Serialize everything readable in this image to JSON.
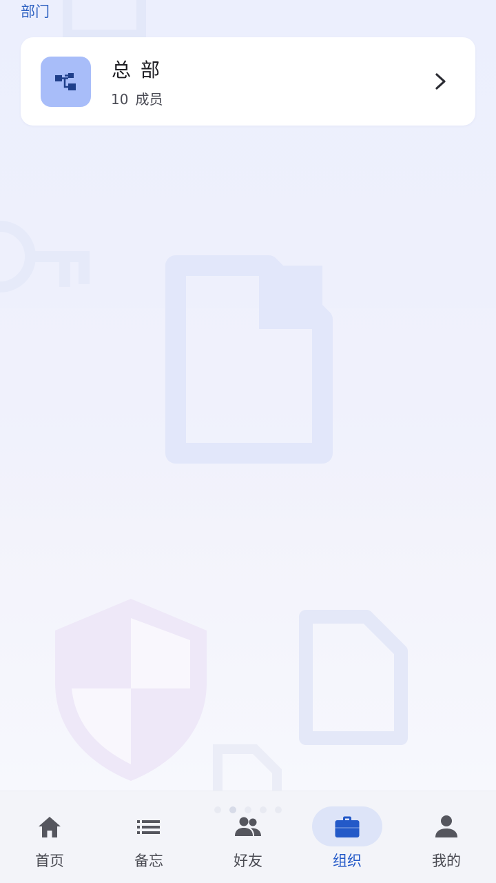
{
  "section": {
    "label": "部门"
  },
  "departments": [
    {
      "name": "总部",
      "member_count": "10",
      "member_unit": "成员",
      "icon": "org-chart-icon"
    }
  ],
  "pagination": {
    "count": 5,
    "active_index": 1
  },
  "tabbar": {
    "active_index": 3,
    "tabs": [
      {
        "label": "首页",
        "icon": "home-icon"
      },
      {
        "label": "备忘",
        "icon": "list-icon"
      },
      {
        "label": "好友",
        "icon": "people-icon"
      },
      {
        "label": "组织",
        "icon": "briefcase-icon"
      },
      {
        "label": "我的",
        "icon": "person-icon"
      }
    ]
  },
  "colors": {
    "accent": "#2359c8",
    "section_label": "#2f62c2",
    "dept_icon_bg": "#a8bdf9",
    "active_tab_bg": "#dde4f8",
    "inactive_tab": "#4a4b53"
  }
}
